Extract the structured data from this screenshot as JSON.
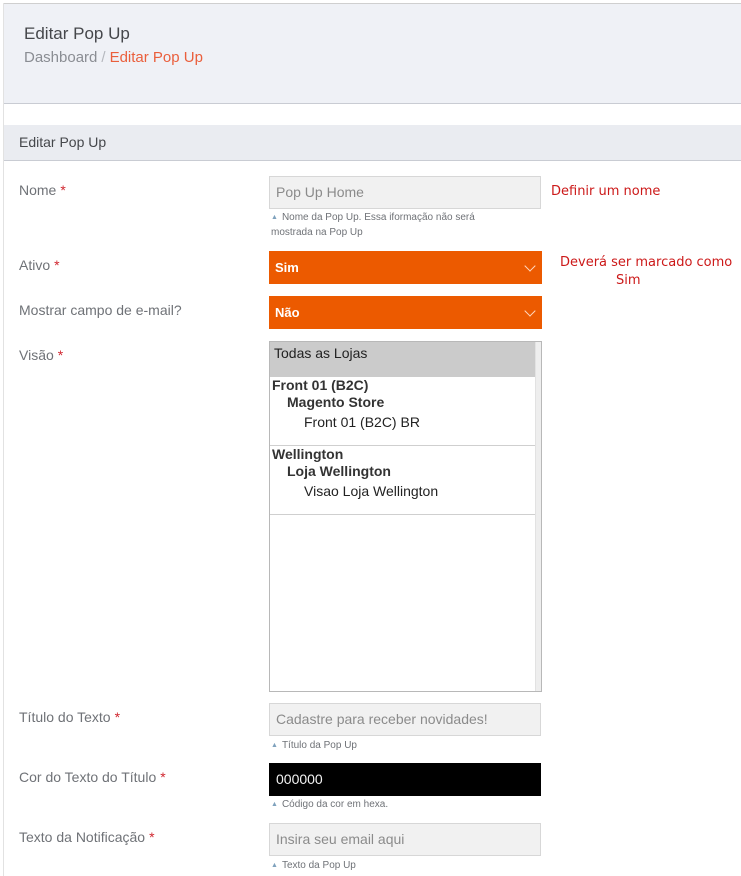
{
  "header": {
    "title": "Editar Pop Up",
    "breadcrumb": {
      "root": "Dashboard",
      "separator": "/",
      "current": "Editar Pop Up"
    }
  },
  "section": {
    "title": "Editar Pop Up"
  },
  "required_mark": "*",
  "fields": {
    "nome": {
      "label": "Nome",
      "value": "Pop Up Home",
      "hint_line1": "Nome da Pop Up. Essa iformação não será",
      "hint_line2": "mostrada na Pop Up"
    },
    "ativo": {
      "label": "Ativo",
      "value": "Sim"
    },
    "mostrar_email": {
      "label": "Mostrar campo de e-mail?",
      "value": "Não"
    },
    "visao": {
      "label": "Visão",
      "options": {
        "all": "Todas as Lojas",
        "g1": "Front 01 (B2C)",
        "g1_store": "Magento Store",
        "g1_view": "Front 01 (B2C) BR",
        "g2": "Wellington",
        "g2_store": "Loja Wellington",
        "g2_view": "Visao Loja Wellington"
      },
      "selected": "Todas as Lojas"
    },
    "titulo_texto": {
      "label": "Título do Texto",
      "placeholder": "Cadastre para receber novidades!",
      "hint": "Título da Pop Up"
    },
    "cor_titulo": {
      "label": "Cor do Texto do Título",
      "value": "000000",
      "hint": "Código da cor em hexa."
    },
    "texto_notificacao": {
      "label": "Texto da Notificação",
      "placeholder": "Insira seu email aqui",
      "hint": "Texto da Pop Up"
    }
  },
  "annotations": {
    "nome": "Definir um nome",
    "ativo_line1": "Deverá ser marcado como",
    "ativo_line2": "Sim"
  },
  "colors": {
    "accent": "#ec5a00",
    "breadcrumb_active": "#ea5f3c",
    "required": "#d0262f",
    "annotation": "#cc1919"
  }
}
